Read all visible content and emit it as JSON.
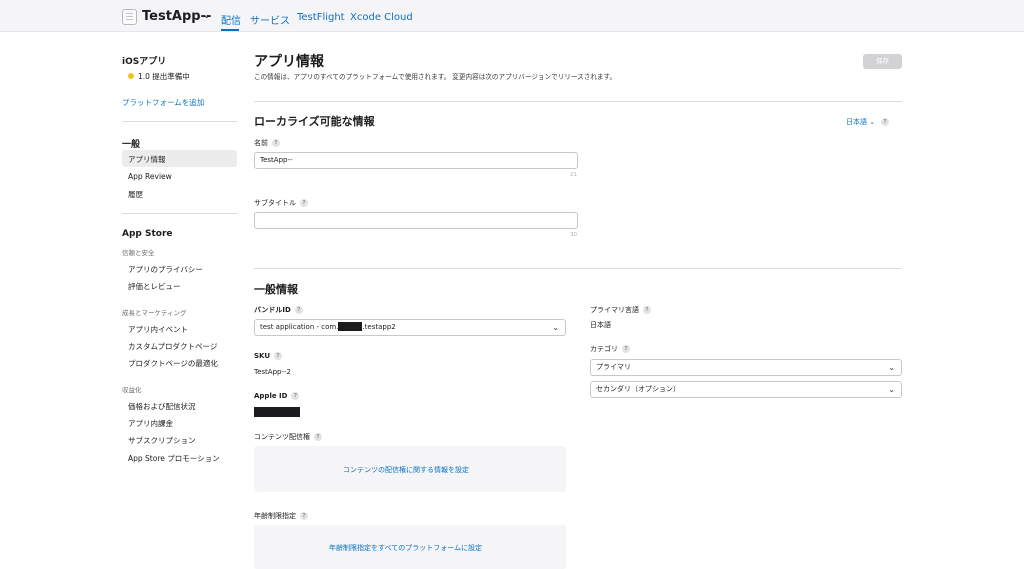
{
  "header": {
    "app_name": "TestApp--",
    "nav": [
      "配信",
      "サービス",
      "TestFlight",
      "Xcode Cloud"
    ],
    "accent_color": "#0b72c4"
  },
  "sidebar": {
    "platform_title": "iOSアプリ",
    "version_status": "1.0 提出準備中",
    "status_color": "#f0c419",
    "add_platform": "プラットフォームを追加",
    "general_title": "一般",
    "general_items": [
      "アプリ情報",
      "App Review",
      "履歴"
    ],
    "appstore_title": "App Store",
    "group_trust": "信頼と安全",
    "trust_items": [
      "アプリのプライバシー",
      "評価とレビュー"
    ],
    "group_growth": "成長とマーケティング",
    "growth_items": [
      "アプリ内イベント",
      "カスタムプロダクトページ",
      "プロダクトページの最適化"
    ],
    "group_monetize": "収益化",
    "monetize_items": [
      "価格および配信状況",
      "アプリ内課金",
      "サブスクリプション",
      "App Store プロモーション"
    ]
  },
  "main": {
    "title": "アプリ情報",
    "subtitle": "この情報は、アプリのすべてのプラットフォームで使用されます。 変更内容は次のアプリバージョンでリリースされます。",
    "save_label": "保存",
    "localizable": {
      "title": "ローカライズ可能な情報",
      "language": "日本語",
      "name_label": "名前",
      "name_value": "TestApp--",
      "name_counter": "21",
      "subtitle_label": "サブタイトル",
      "subtitle_value": "",
      "subtitle_counter": "30"
    },
    "general": {
      "title": "一般情報",
      "bundle_label": "バンドルID",
      "bundle_value_prefix": "test application - com.",
      "bundle_value_suffix": ".testapp2",
      "sku_label": "SKU",
      "sku_value": "TestApp--2",
      "apple_id_label": "Apple ID",
      "content_rights_label": "コンテンツ配信権",
      "content_rights_link": "コンテンツの配信権に関する情報を設定",
      "age_rating_label": "年齢制限指定",
      "age_rating_link": "年齢制限指定をすべてのプラットフォームに設定",
      "primary_language_label": "プライマリ言語",
      "primary_language_value": "日本語",
      "category_label": "カテゴリ",
      "primary_category": "プライマリ",
      "secondary_category": "セカンダリ（オプション）"
    }
  }
}
